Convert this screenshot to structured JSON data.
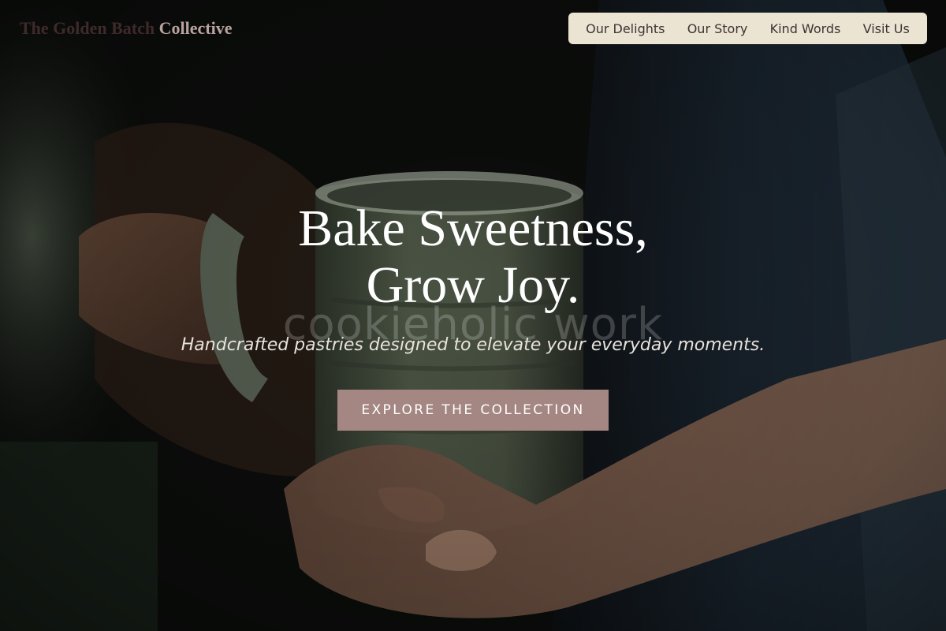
{
  "brand": {
    "part1": "The Golden Batch ",
    "part2": "Collective"
  },
  "nav": {
    "items": [
      {
        "label": "Our Delights"
      },
      {
        "label": "Our Story"
      },
      {
        "label": "Kind Words"
      },
      {
        "label": "Visit Us"
      }
    ]
  },
  "hero": {
    "headline_line1": "Bake Sweetness,",
    "headline_line2": "Grow Joy.",
    "watermark": "cookieholic work",
    "subtitle": "Handcrafted pastries designed to elevate your everyday moments.",
    "cta_label": "EXPLORE THE COLLECTION"
  },
  "colors": {
    "nav_background": "#ebe4d2",
    "cta_background": "#a48782",
    "brand_dim": "#3e2a2a",
    "brand_bright": "#b9a3a0"
  }
}
